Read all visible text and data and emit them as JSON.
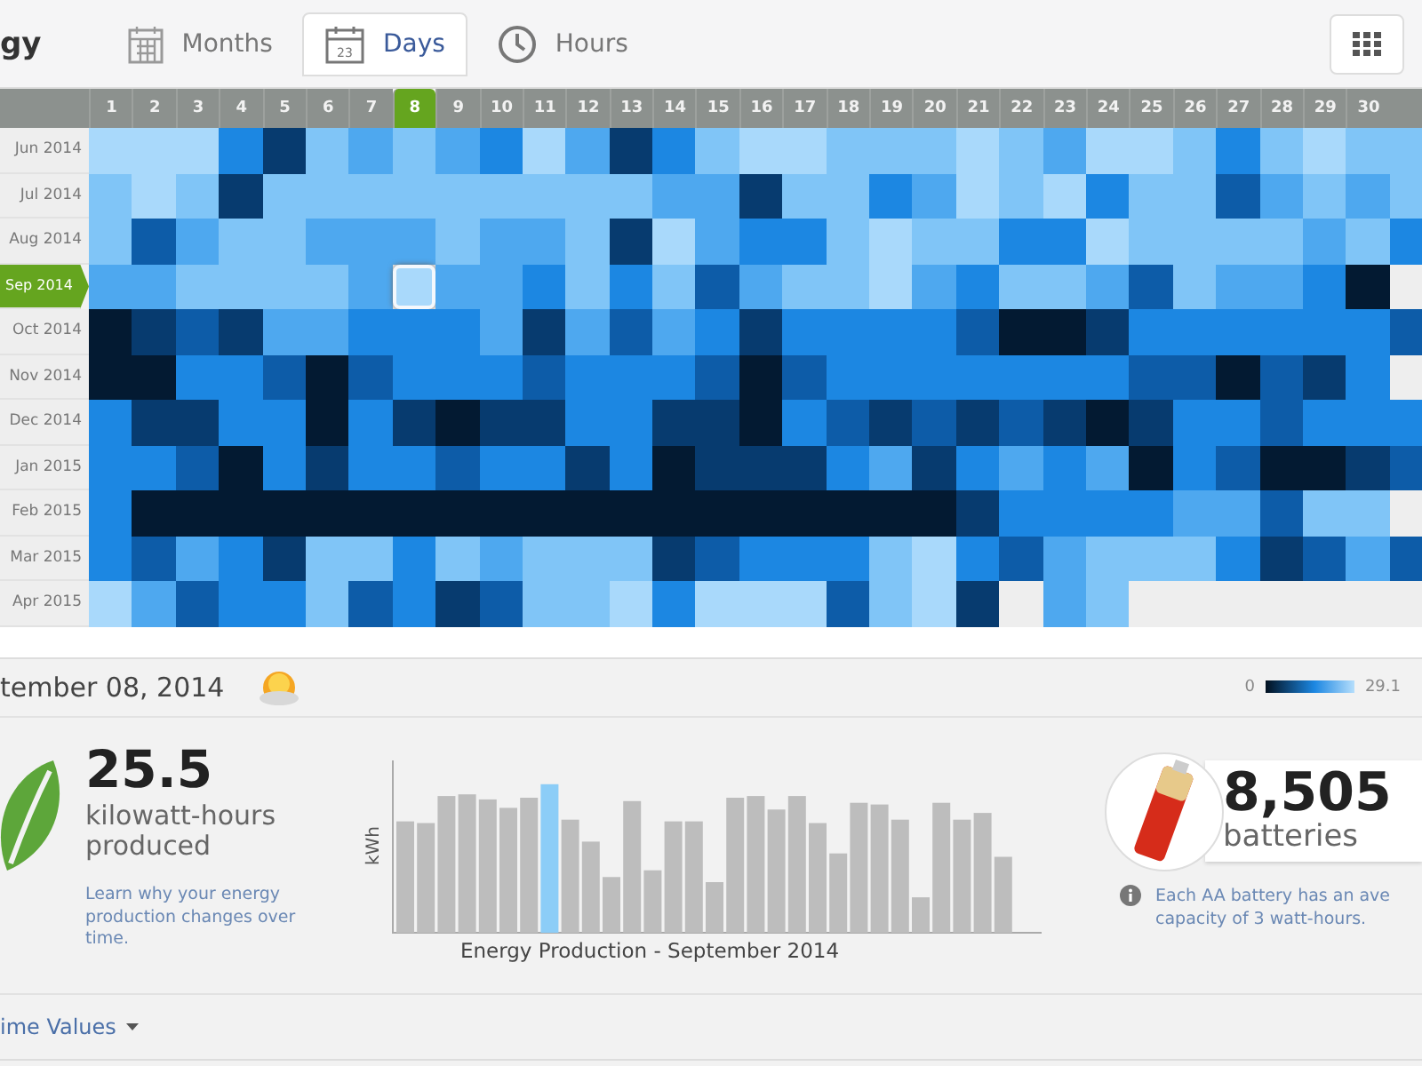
{
  "app": {
    "title": "gy"
  },
  "view_tabs": [
    {
      "kind": "months",
      "label": "Months",
      "selected": false
    },
    {
      "kind": "days",
      "label": "Days",
      "icon_text": "23",
      "selected": true
    },
    {
      "kind": "hours",
      "label": "Hours",
      "selected": false
    }
  ],
  "heatmap": {
    "days": [
      {
        "label": "1",
        "selected": false
      },
      {
        "label": "2",
        "selected": false
      },
      {
        "label": "3",
        "selected": false
      },
      {
        "label": "4",
        "selected": false
      },
      {
        "label": "5",
        "selected": false
      },
      {
        "label": "6",
        "selected": false
      },
      {
        "label": "7",
        "selected": false
      },
      {
        "label": "8",
        "selected": true
      },
      {
        "label": "9",
        "selected": false
      },
      {
        "label": "10",
        "selected": false
      },
      {
        "label": "11",
        "selected": false
      },
      {
        "label": "12",
        "selected": false
      },
      {
        "label": "13",
        "selected": false
      },
      {
        "label": "14",
        "selected": false
      },
      {
        "label": "15",
        "selected": false
      },
      {
        "label": "16",
        "selected": false
      },
      {
        "label": "17",
        "selected": false
      },
      {
        "label": "18",
        "selected": false
      },
      {
        "label": "19",
        "selected": false
      },
      {
        "label": "20",
        "selected": false
      },
      {
        "label": "21",
        "selected": false
      },
      {
        "label": "22",
        "selected": false
      },
      {
        "label": "23",
        "selected": false
      },
      {
        "label": "24",
        "selected": false
      },
      {
        "label": "25",
        "selected": false
      },
      {
        "label": "26",
        "selected": false
      },
      {
        "label": "27",
        "selected": false
      },
      {
        "label": "28",
        "selected": false
      },
      {
        "label": "29",
        "selected": false
      },
      {
        "label": "30",
        "selected": false
      }
    ],
    "months": [
      {
        "label": "Jun 2014",
        "selected": false
      },
      {
        "label": "Jul 2014",
        "selected": false
      },
      {
        "label": "Aug 2014",
        "selected": false
      },
      {
        "label": "Sep 2014",
        "selected": true
      },
      {
        "label": "Oct 2014",
        "selected": false
      },
      {
        "label": "Nov 2014",
        "selected": false
      },
      {
        "label": "Dec 2014",
        "selected": false
      },
      {
        "label": "Jan 2015",
        "selected": false
      },
      {
        "label": "Feb 2015",
        "selected": false
      },
      {
        "label": "Mar 2015",
        "selected": false
      },
      {
        "label": "Apr 2015",
        "selected": false
      }
    ]
  },
  "detail": {
    "date": "tember 08, 2014",
    "legend": {
      "min": "0",
      "max": "29.1"
    },
    "energy": {
      "value": "25.5",
      "unit": "kilowatt-hours produced",
      "link": "Learn why your energy production changes over time."
    },
    "chart": {
      "ylabel": "kWh",
      "title": "Energy Production - September 2014"
    },
    "batteries": {
      "value": "8,505",
      "unit": "batteries",
      "note_lines": [
        "Each AA battery has an ave",
        "capacity of 3 watt-hours."
      ]
    }
  },
  "footer": {
    "dropdown": "ime Values"
  }
}
